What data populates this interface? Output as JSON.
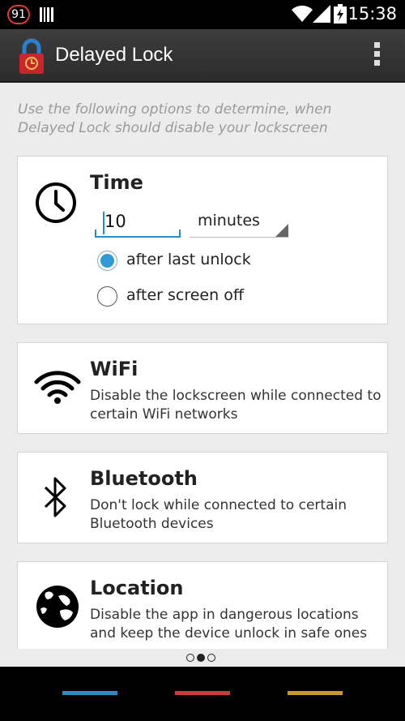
{
  "status_bar": {
    "badge": "91",
    "time": "15:38"
  },
  "action_bar": {
    "title": "Delayed Lock",
    "app_icon": "padlock-timer-icon",
    "overflow_icon": "overflow-menu-icon"
  },
  "intro": "Use the following options to determine, when Delayed Lock should disable your lockscreen",
  "time_card": {
    "icon": "clock-icon",
    "title": "Time",
    "value": "10",
    "unit": "minutes",
    "options": [
      {
        "label": "after last unlock",
        "checked": true
      },
      {
        "label": "after screen off",
        "checked": false
      }
    ]
  },
  "wifi_card": {
    "icon": "wifi-icon",
    "title": "WiFi",
    "description": "Disable the lockscreen while connected to certain WiFi networks"
  },
  "bluetooth_card": {
    "icon": "bluetooth-icon",
    "title": "Bluetooth",
    "description": "Don't lock while connected to certain Bluetooth devices"
  },
  "location_card": {
    "icon": "globe-icon",
    "title": "Location",
    "description": "Disable the app in dangerous locations and keep the device unlock in safe ones"
  },
  "pager": {
    "count": 3,
    "active": 1
  },
  "nav_buttons": [
    {
      "name": "nav-blue",
      "color": "#2b8cbf"
    },
    {
      "name": "nav-red",
      "color": "#c83c3c"
    },
    {
      "name": "nav-gold",
      "color": "#c99a2a"
    }
  ],
  "colors": {
    "accent": "#2e9ad6",
    "action_bar": "#333333"
  }
}
